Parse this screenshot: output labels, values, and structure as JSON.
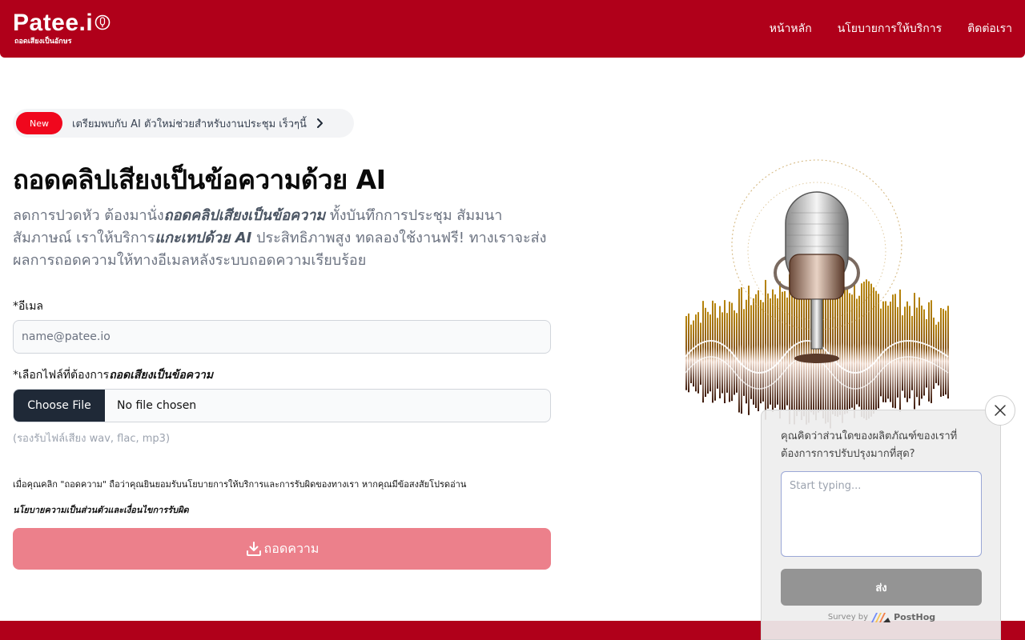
{
  "brand": {
    "name": "Patee.i",
    "tagline": "ถอดเสียงเป็นอักษร"
  },
  "nav": {
    "items": [
      "หน้าหลัก",
      "นโยบายการให้บริการ",
      "ติดต่อเรา"
    ]
  },
  "banner": {
    "badge": "New",
    "text": "เตรียมพบกับ AI ตัวใหม่ช่วยสำหรับงานประชุม เร็วๆนี้"
  },
  "hero": {
    "title": "ถอดคลิปเสียงเป็นข้อความด้วย AI",
    "lead_1": "ลดการปวดหัว ต้องมานั่ง",
    "lead_2": "ถอดคลิปเสียงเป็นข้อความ",
    "lead_3": " ทั้งบันทึกการประชุม สัมมนา สัมภาษณ์ เราให้บริการ",
    "lead_4": "แกะเทปด้วย AI",
    "lead_5": " ประสิทธิภาพสูง ทดลองใช้งานฟรี! ทางเราจะส่งผลการถอดความให้ทางอีเมลหลังระบบถอดความเรียบร้อย"
  },
  "form": {
    "email_label": "*อีเมล",
    "email_placeholder": "name@patee.io",
    "file_label_1": "*เลือกไฟล์ที่ต้องการ",
    "file_label_2": "ถอดเสียงเป็นข้อความ",
    "file_button": "Choose File",
    "file_status": "No file chosen",
    "file_hint": "(รองรับไฟล์เสียง wav, flac, mp3)",
    "consent": "เมื่อคุณคลิก \"ถอดความ\" ถือว่าคุณยินยอมรับนโยบายการให้บริการและการรับผิดของทางเรา หากคุณมีข้อสงสัยโปรดอ่าน",
    "policy_link": "นโยบายความเป็นส่วนตัวและเงื่อนไขการรับผิด",
    "submit": "ถอดความ"
  },
  "survey": {
    "question": "คุณคิดว่าส่วนใดของผลิตภัณฑ์ของเราที่ต้องการการปรับปรุงมากที่สุด?",
    "placeholder": "Start typing...",
    "send": "ส่ง",
    "by": "Survey by",
    "vendor": "PostHog"
  },
  "colors": {
    "brand": "#b0001a",
    "badge": "#f0071d",
    "submit": "#ec808b"
  }
}
